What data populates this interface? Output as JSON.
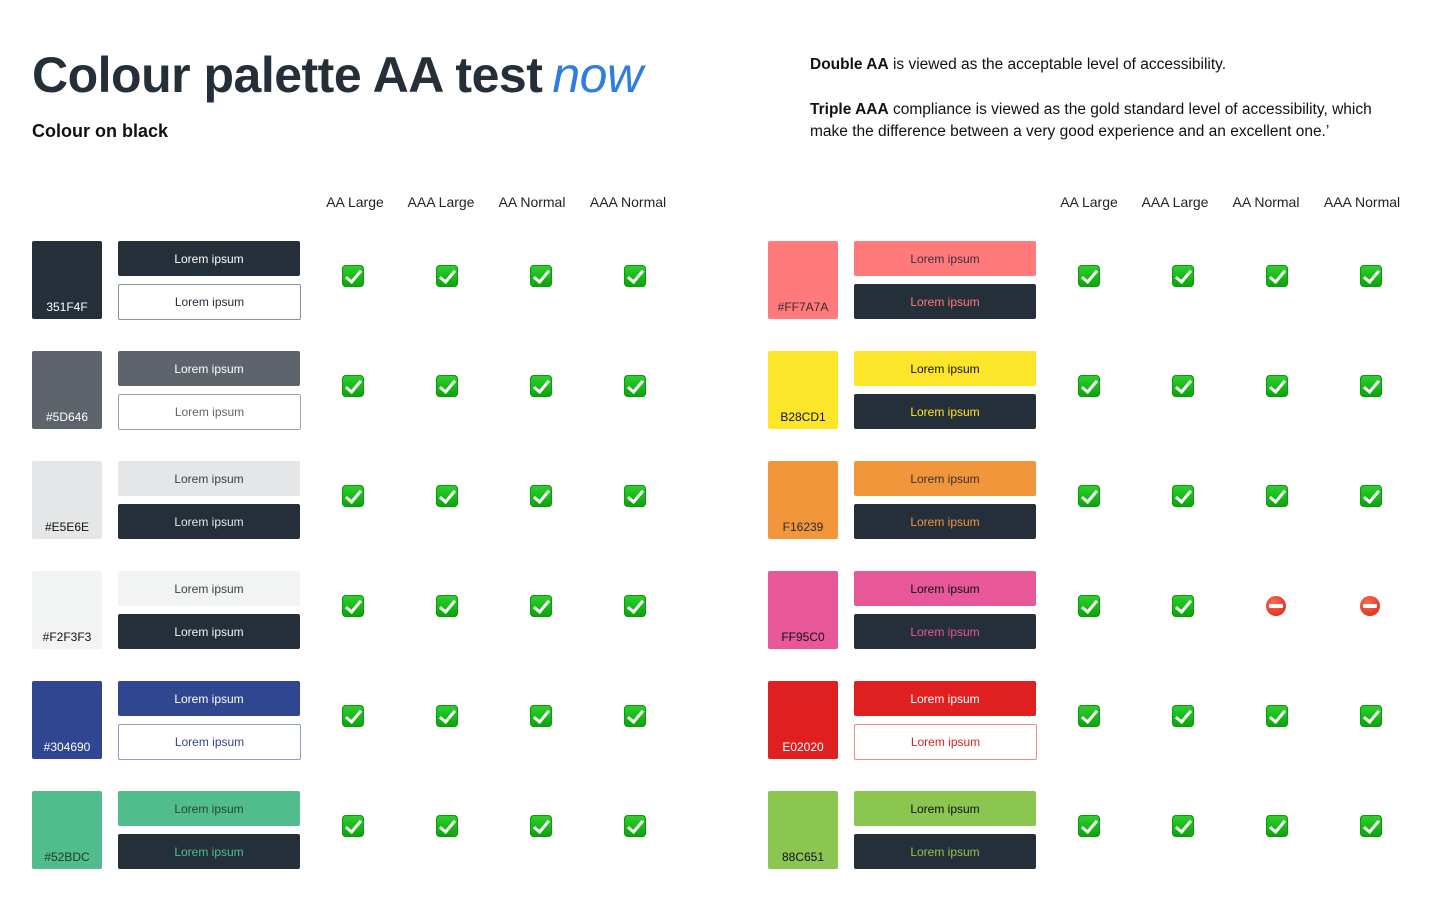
{
  "header": {
    "title": "Colour palette AA test",
    "title_accent": "now",
    "subtitle": "Colour on black",
    "info_1_bold": "Double AA",
    "info_1_text": " is viewed as the acceptable level of accessibility.",
    "info_2_bold": "Triple AAA",
    "info_2_text": " compliance is viewed as the gold standard level of accessibility, which make the difference between a very good experience and an excellent one.’"
  },
  "columns": [
    "AA Large",
    "AAA Large",
    "AA Normal",
    "AAA Normal"
  ],
  "button_label": "Lorem ipsum",
  "left_rows": [
    {
      "hex": "351F4F",
      "color": "#252f3a",
      "label_color": "#ffffff",
      "b1": {
        "bg": "#252f3a",
        "fg": "#ffffff",
        "border": ""
      },
      "b2": {
        "bg": "#ffffff",
        "fg": "#252f3a",
        "border": "#8a9099"
      },
      "results": [
        "pass",
        "pass",
        "pass",
        "pass"
      ]
    },
    {
      "hex": "#5D646",
      "color": "#5d646c",
      "label_color": "#ffffff",
      "b1": {
        "bg": "#5d646c",
        "fg": "#ffffff",
        "border": ""
      },
      "b2": {
        "bg": "#ffffff",
        "fg": "#5d646c",
        "border": "#a0a4aa"
      },
      "results": [
        "pass",
        "pass",
        "pass",
        "pass"
      ]
    },
    {
      "hex": "#E5E6E",
      "color": "#e5e6e7",
      "label_color": "#111111",
      "b1": {
        "bg": "#e5e6e7",
        "fg": "#3a4048",
        "border": ""
      },
      "b2": {
        "bg": "#252f3a",
        "fg": "#e5e6e7",
        "border": ""
      },
      "results": [
        "pass",
        "pass",
        "pass",
        "pass"
      ]
    },
    {
      "hex": "#F2F3F3",
      "color": "#f2f3f3",
      "label_color": "#111111",
      "b1": {
        "bg": "#f2f3f3",
        "fg": "#3a4048",
        "border": ""
      },
      "b2": {
        "bg": "#252f3a",
        "fg": "#f2f3f3",
        "border": ""
      },
      "results": [
        "pass",
        "pass",
        "pass",
        "pass"
      ]
    },
    {
      "hex": "#304690",
      "color": "#304690",
      "label_color": "#ffffff",
      "b1": {
        "bg": "#304690",
        "fg": "#ffffff",
        "border": ""
      },
      "b2": {
        "bg": "#ffffff",
        "fg": "#304690",
        "border": "#8c9bc8"
      },
      "results": [
        "pass",
        "pass",
        "pass",
        "pass"
      ]
    },
    {
      "hex": "#52BDC",
      "color": "#52bd8c",
      "label_color": "#1f3a2e",
      "b1": {
        "bg": "#52bd8c",
        "fg": "#24453a",
        "border": ""
      },
      "b2": {
        "bg": "#252f3a",
        "fg": "#52bd8c",
        "border": ""
      },
      "results": [
        "pass",
        "pass",
        "pass",
        "pass"
      ]
    }
  ],
  "right_rows": [
    {
      "hex": "#FF7A7A",
      "color": "#ff7a7a",
      "label_color": "#3a2a2e",
      "b1": {
        "bg": "#ff7a7a",
        "fg": "#3a3040",
        "border": ""
      },
      "b2": {
        "bg": "#252f3a",
        "fg": "#ff7a7a",
        "border": ""
      },
      "results": [
        "pass",
        "pass",
        "pass",
        "pass"
      ]
    },
    {
      "hex": "B28CD1",
      "color": "#fde62a",
      "label_color": "#111111",
      "b1": {
        "bg": "#fde62a",
        "fg": "#111111",
        "border": ""
      },
      "b2": {
        "bg": "#252f3a",
        "fg": "#fde62a",
        "border": ""
      },
      "results": [
        "pass",
        "pass",
        "pass",
        "pass"
      ]
    },
    {
      "hex": "F16239",
      "color": "#f2963b",
      "label_color": "#2a2a2a",
      "b1": {
        "bg": "#f2963b",
        "fg": "#3a3030",
        "border": ""
      },
      "b2": {
        "bg": "#252f3a",
        "fg": "#f2963b",
        "border": ""
      },
      "results": [
        "pass",
        "pass",
        "pass",
        "pass"
      ]
    },
    {
      "hex": "FF95C0",
      "color": "#e85898",
      "label_color": "#111111",
      "b1": {
        "bg": "#e85898",
        "fg": "#111111",
        "border": ""
      },
      "b2": {
        "bg": "#252f3a",
        "fg": "#e85898",
        "border": ""
      },
      "results": [
        "pass",
        "pass",
        "fail",
        "fail"
      ]
    },
    {
      "hex": "E02020",
      "color": "#e02020",
      "label_color": "#ffffff",
      "b1": {
        "bg": "#e02020",
        "fg": "#ffffff",
        "border": ""
      },
      "b2": {
        "bg": "#ffffff",
        "fg": "#e02020",
        "border": "#ef8a8a"
      },
      "results": [
        "pass",
        "pass",
        "pass",
        "pass"
      ]
    },
    {
      "hex": "88C651",
      "color": "#8bc651",
      "label_color": "#111111",
      "b1": {
        "bg": "#8bc651",
        "fg": "#111111",
        "border": ""
      },
      "b2": {
        "bg": "#252f3a",
        "fg": "#8bc651",
        "border": ""
      },
      "results": [
        "pass",
        "pass",
        "pass",
        "pass"
      ]
    }
  ]
}
